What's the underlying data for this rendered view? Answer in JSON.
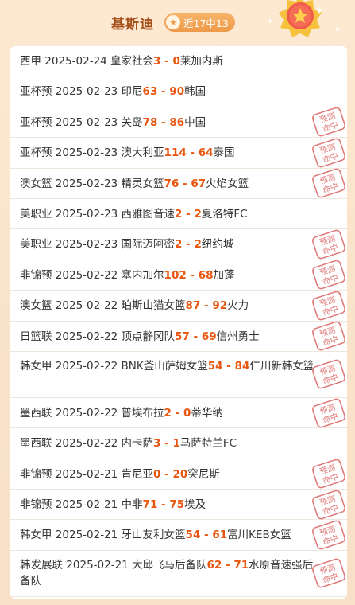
{
  "header": {
    "title": "基斯迪",
    "badge_text": "近17中13",
    "badge_icon": "star-icon"
  },
  "stamp_text": [
    "预测",
    "命中"
  ],
  "colors": {
    "score": "#e8560f",
    "title": "#a5501a",
    "badge": "#ee9a4a",
    "stamp": "#e07a7a"
  },
  "matches": [
    {
      "league": "西甲",
      "date": "2025-02-24",
      "home": "皇家社会",
      "home_score": "3",
      "away_score": "0",
      "away": "莱加内斯",
      "hit": false
    },
    {
      "league": "亚杯预",
      "date": "2025-02-23",
      "home": "印尼",
      "home_score": "63",
      "away_score": "90",
      "away": "韩国",
      "hit": false
    },
    {
      "league": "亚杯预",
      "date": "2025-02-23",
      "home": "关岛",
      "home_score": "78",
      "away_score": "86",
      "away": "中国",
      "hit": true
    },
    {
      "league": "亚杯预",
      "date": "2025-02-23",
      "home": "澳大利亚",
      "home_score": "114",
      "away_score": "64",
      "away": "泰国",
      "hit": true
    },
    {
      "league": "澳女篮",
      "date": "2025-02-23",
      "home": "精灵女篮",
      "home_score": "76",
      "away_score": "67",
      "away": "火焰女篮",
      "hit": true
    },
    {
      "league": "美职业",
      "date": "2025-02-23",
      "home": "西雅图音速",
      "home_score": "2",
      "away_score": "2",
      "away": "夏洛特FC",
      "hit": false
    },
    {
      "league": "美职业",
      "date": "2025-02-23",
      "home": "国际迈阿密",
      "home_score": "2",
      "away_score": "2",
      "away": "纽约城",
      "hit": true
    },
    {
      "league": "非锦预",
      "date": "2025-02-22",
      "home": "塞内加尔",
      "home_score": "102",
      "away_score": "68",
      "away": "加蓬",
      "hit": true
    },
    {
      "league": "澳女篮",
      "date": "2025-02-22",
      "home": "珀斯山猫女篮",
      "home_score": "87",
      "away_score": "92",
      "away": "火力",
      "hit": true
    },
    {
      "league": "日篮联",
      "date": "2025-02-22",
      "home": "顶点静冈队",
      "home_score": "57",
      "away_score": "69",
      "away": "信州勇士",
      "hit": true
    },
    {
      "league": "韩女甲",
      "date": "2025-02-22",
      "home": "BNK釜山萨姆女篮",
      "home_score": "54",
      "away_score": "84",
      "away": "仁川新韩女篮",
      "hit": true,
      "double": true
    },
    {
      "league": "墨西联",
      "date": "2025-02-22",
      "home": "普埃布拉",
      "home_score": "2",
      "away_score": "0",
      "away": "蒂华纳",
      "hit": true
    },
    {
      "league": "墨西联",
      "date": "2025-02-22",
      "home": "内卡萨",
      "home_score": "3",
      "away_score": "1",
      "away": "马萨特兰FC",
      "hit": false
    },
    {
      "league": "非锦预",
      "date": "2025-02-21",
      "home": "肯尼亚",
      "home_score": "0",
      "away_score": "20",
      "away": "突尼斯",
      "hit": true
    },
    {
      "league": "非锦预",
      "date": "2025-02-21",
      "home": "中非",
      "home_score": "71",
      "away_score": "75",
      "away": "埃及",
      "hit": true
    },
    {
      "league": "韩女甲",
      "date": "2025-02-21",
      "home": "牙山友利女篮",
      "home_score": "54",
      "away_score": "61",
      "away": "富川KEB女篮",
      "hit": true
    },
    {
      "league": "韩发展联",
      "date": "2025-02-21",
      "home": "大邱飞马后备队",
      "home_score": "62",
      "away_score": "71",
      "away": "水原音速强后备队",
      "hit": true,
      "double": true
    }
  ]
}
